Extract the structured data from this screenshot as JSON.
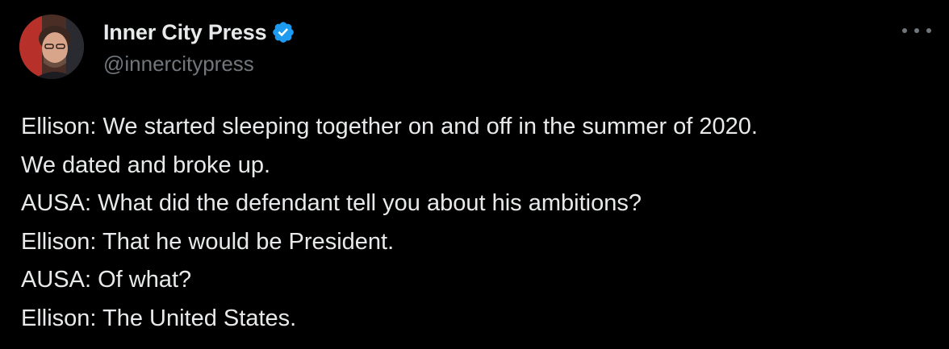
{
  "author": {
    "display_name": "Inner City Press",
    "handle": "@innercitypress",
    "verified": true,
    "avatar_icon": "profile-photo",
    "verified_icon": "verified-badge-icon"
  },
  "more_icon": "more-horizontal-icon",
  "tweet": {
    "lines": [
      "Ellison: We started sleeping together on and off in the summer of 2020.",
      "We dated and broke up.",
      "AUSA: What did the defendant tell you about his ambitions?",
      "Ellison: That he would be President.",
      "AUSA: Of what?",
      "Ellison: The United States."
    ]
  },
  "colors": {
    "background": "#000000",
    "text_primary": "#e7e9ea",
    "text_secondary": "#71767b",
    "verified_blue": "#1d9bf0"
  }
}
